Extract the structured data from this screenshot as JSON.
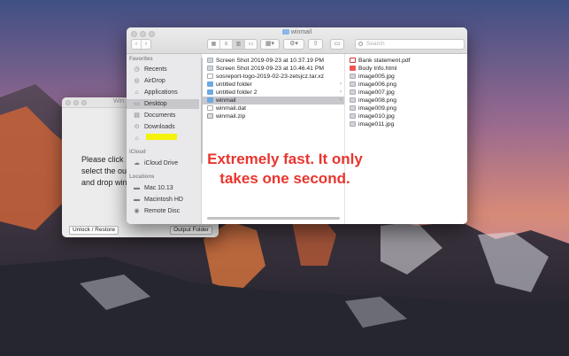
{
  "app_window": {
    "title": "Win",
    "instruction_lines": [
      "Please click",
      "select the ou",
      "and drop win"
    ],
    "unlock_button": "Unlock / Restore",
    "output_button": "Output Folder"
  },
  "finder": {
    "title": "winmail",
    "search_placeholder": "Search",
    "sidebar": {
      "favorites_header": "Favorites",
      "favorites": [
        {
          "label": "Recents",
          "icon": "clock-icon"
        },
        {
          "label": "AirDrop",
          "icon": "airdrop-icon"
        },
        {
          "label": "Applications",
          "icon": "applications-icon"
        },
        {
          "label": "Desktop",
          "icon": "desktop-icon"
        },
        {
          "label": "Documents",
          "icon": "documents-icon"
        },
        {
          "label": "Downloads",
          "icon": "downloads-icon"
        },
        {
          "label": "",
          "icon": "home-icon"
        }
      ],
      "icloud_header": "iCloud",
      "icloud": [
        {
          "label": "iCloud Drive",
          "icon": "cloud-icon"
        }
      ],
      "locations_header": "Locations",
      "locations": [
        {
          "label": "Mac 10.13",
          "icon": "drive-icon"
        },
        {
          "label": "Macintosh HD",
          "icon": "drive-icon"
        },
        {
          "label": "Remote Disc",
          "icon": "disc-icon"
        }
      ]
    },
    "column1": [
      {
        "name": "Screen Shot 2019-09-23 at 10.37.19 PM",
        "kind": "img"
      },
      {
        "name": "Screen Shot 2019-09-23 at 10.46.41 PM",
        "kind": "img"
      },
      {
        "name": "sosreport-togo-2019-02-23-zetsjcz.tar.xz",
        "kind": "doc"
      },
      {
        "name": "untitled folder",
        "kind": "fold"
      },
      {
        "name": "untitled folder 2",
        "kind": "fold"
      },
      {
        "name": "winmail",
        "kind": "fold"
      },
      {
        "name": "winmail.dat",
        "kind": "doc"
      },
      {
        "name": "winmail.zip",
        "kind": "zip"
      }
    ],
    "column2": [
      {
        "name": "Bank statement.pdf",
        "kind": "pdf"
      },
      {
        "name": "Body Info.html",
        "kind": "red"
      },
      {
        "name": "image005.jpg",
        "kind": "img"
      },
      {
        "name": "image006.png",
        "kind": "img"
      },
      {
        "name": "image007.jpg",
        "kind": "img"
      },
      {
        "name": "image008.png",
        "kind": "img"
      },
      {
        "name": "image009.png",
        "kind": "img"
      },
      {
        "name": "image010.jpg",
        "kind": "img"
      },
      {
        "name": "image011.jpg",
        "kind": "img"
      }
    ]
  },
  "overlay_caption": "Extremely fast. It only takes one second.",
  "colors": {
    "caption": "#e8352e",
    "highlight": "#f4f20a",
    "selection": "#c7c7cc"
  }
}
